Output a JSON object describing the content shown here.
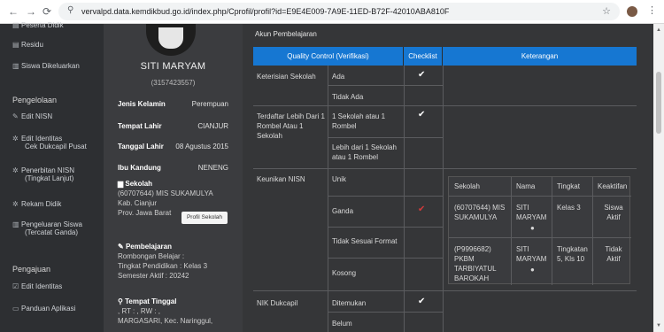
{
  "browser": {
    "url": "vervalpd.data.kemdikbud.go.id/index.php/Cprofil/profil?id=E9E4E009-7A9E-11ED-B72F-42010ABA810F",
    "back": "←",
    "forward": "→",
    "reload": "⟳",
    "site_info": "⚲",
    "bookmark": "☆",
    "menu": "⋮"
  },
  "sidebar": {
    "top_items": [
      {
        "label": "Peserta Didik",
        "icon": "users-icon"
      },
      {
        "label": "Residu",
        "icon": "list-icon"
      },
      {
        "label": "Siswa Dikeluarkan",
        "icon": "trash-icon"
      }
    ],
    "sections": [
      {
        "title": "Pengelolaan"
      },
      {
        "title": "Pengajuan"
      }
    ],
    "pengelolaan_items": [
      {
        "label": "Edit NISN",
        "icon": "edit-icon"
      },
      {
        "label": "Edit Identitas",
        "label2": "Cek Dukcapil Pusat",
        "icon": "gear-icon"
      },
      {
        "label": "Penerbitan NISN",
        "label2": "(Tingkat Lanjut)",
        "icon": "gear-icon"
      },
      {
        "label": "Rekam Didik",
        "icon": "gear-icon"
      },
      {
        "label": "Pengeluaran Siswa",
        "label2": "(Tercatat Ganda)",
        "icon": "trash-icon"
      }
    ],
    "pengajuan_items": [
      {
        "label": "Edit Identitas",
        "icon": "edit-icon"
      },
      {
        "label": "Panduan Aplikasi",
        "icon": "document-icon"
      }
    ]
  },
  "profile": {
    "name": "SITI MARYAM",
    "nisn": "(3157423557)",
    "fields": [
      {
        "label": "Jenis Kelamin",
        "value": "Perempuan"
      },
      {
        "label": "Tempat Lahir",
        "value": "CIANJUR"
      },
      {
        "label": "Tanggal Lahir",
        "value": "08 Agustus 2015"
      },
      {
        "label": "Ibu Kandung",
        "value": "NENENG"
      }
    ],
    "sekolah": {
      "title": "Sekolah",
      "line1": "(60707644) MIS SUKAMULYA",
      "line2": "Kab. Cianjur",
      "line3": "Prov. Jawa Barat",
      "button": "Profil Sekolah"
    },
    "pembelajaran": {
      "title": "Pembelajaran",
      "line1": "Rombongan Belajar :",
      "line2": "Tingkat Pendidikan : Kelas 3",
      "line3": "Semester Aktif : 20242"
    },
    "tempat_tinggal": {
      "title": "Tempat Tinggal",
      "line1": ", RT : , RW : ,",
      "line2": "MARGASARI, Kec. Naringgul,"
    }
  },
  "main": {
    "title": "Akun Pembelajaran",
    "headers": {
      "col1": "Quality Control (Verifikasi)",
      "col2": "Checklist",
      "col3": "Keterangan"
    },
    "rows": [
      {
        "label": "Keterisian Sekolah",
        "options": [
          {
            "text": "Ada",
            "mark": "✔"
          },
          {
            "text": "Tidak Ada",
            "mark": ""
          }
        ]
      },
      {
        "label": "Terdaftar Lebih Dari 1 Rombel Atau 1 Sekolah",
        "options": [
          {
            "text": "1 Sekolah atau 1 Rombel",
            "mark": "✔"
          },
          {
            "text": "Lebih dari 1 Sekolah atau 1 Rombel",
            "mark": ""
          }
        ]
      },
      {
        "label": "Keunikan NISN",
        "options": [
          {
            "text": "Unik",
            "mark": ""
          },
          {
            "text": "Ganda",
            "mark": "✔"
          },
          {
            "text": "Tidak Sesuai Format",
            "mark": ""
          },
          {
            "text": "Kosong",
            "mark": ""
          }
        ]
      },
      {
        "label": "NIK Dukcapil",
        "options": [
          {
            "text": "Ditemukan",
            "mark": "✔"
          },
          {
            "text": "Belum",
            "mark": ""
          }
        ]
      }
    ],
    "nisn_table": {
      "headers": {
        "sekolah": "Sekolah",
        "nama": "Nama",
        "tingkat": "Tingkat",
        "keaktifan": "Keaktifan"
      },
      "rows": [
        {
          "sekolah": "(60707644) MIS SUKAMULYA",
          "nama": "SITI MARYAM",
          "tingkat": "Kelas 3",
          "keaktifan": "Siswa Aktif"
        },
        {
          "sekolah": "(P9996682) PKBM TARBIYATUL BAROKAH",
          "nama": "SITI MARYAM",
          "tingkat": "Tingkatan 5, Kls 10",
          "keaktifan": "Tidak Aktif"
        }
      ]
    }
  }
}
